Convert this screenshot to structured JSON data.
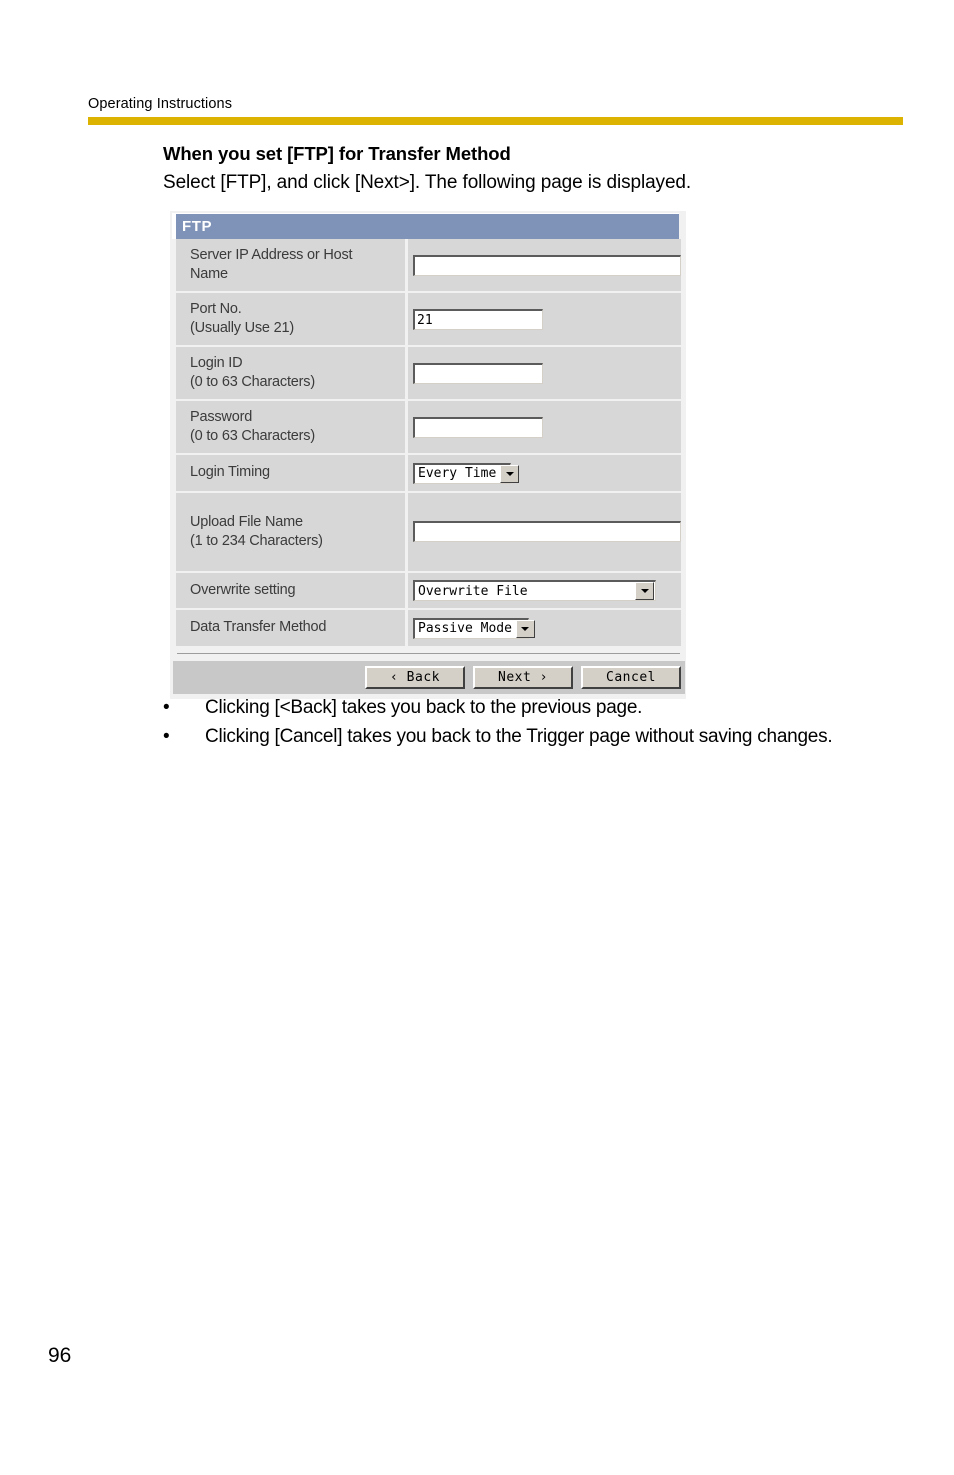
{
  "header": {
    "running_title": "Operating Instructions",
    "rule_color": "#dbb300"
  },
  "content": {
    "section_title": "When you set [FTP] for Transfer Method",
    "section_lead": "Select [FTP], and click [Next>]. The following page is displayed."
  },
  "screenshot": {
    "titlebar_label": "FTP",
    "titlebar_color": "#7f93b8",
    "row_label_color": "#3b3b3b",
    "rows": [
      {
        "label": "Server IP Address or Host",
        "label_line2": "Name",
        "control": "text",
        "value": "",
        "placeholder": ""
      },
      {
        "label": "Port No.",
        "label_line2": "(Usually Use 21)",
        "control": "text",
        "value": "21",
        "placeholder": ""
      },
      {
        "label": "Login ID",
        "label_line2": "(0 to 63 Characters)",
        "control": "text",
        "value": "",
        "placeholder": ""
      },
      {
        "label": "Password",
        "label_line2": "(0 to 63 Characters)",
        "control": "text",
        "value": "",
        "placeholder": ""
      },
      {
        "label": "Login Timing",
        "label_line2": "",
        "control": "select",
        "value": "Every Time"
      },
      {
        "label": "Upload File Name",
        "label_line2": "(1 to 234 Characters)",
        "control": "text",
        "value": "",
        "placeholder": ""
      },
      {
        "label": "Overwrite setting",
        "label_line2": "",
        "control": "select",
        "value": "Overwrite File"
      },
      {
        "label": "Data Transfer Method",
        "label_line2": "",
        "control": "select",
        "value": "Passive Mode"
      }
    ],
    "buttons": [
      {
        "label": "‹ Back"
      },
      {
        "label": "Next ›"
      },
      {
        "label": "Cancel"
      }
    ]
  },
  "notes": [
    {
      "bullet": "•",
      "text": "Clicking [<Back] takes you back to the previous page."
    },
    {
      "bullet": "•",
      "text": "Clicking [Cancel] takes you back to the Trigger page without saving changes."
    }
  ],
  "footer": {
    "page_number": "96"
  }
}
